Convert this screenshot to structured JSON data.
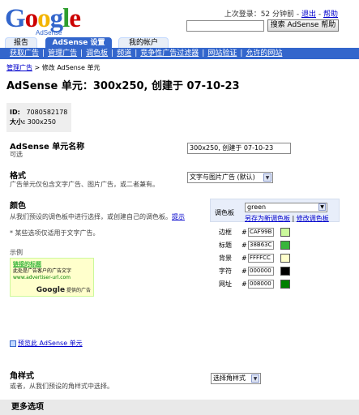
{
  "logo": {
    "text": "Google",
    "sub": "AdSense",
    "letters": [
      {
        "c": "G",
        "color": "#3366cc"
      },
      {
        "c": "o",
        "color": "#cc0000"
      },
      {
        "c": "o",
        "color": "#f3b400"
      },
      {
        "c": "g",
        "color": "#3366cc"
      },
      {
        "c": "l",
        "color": "#2e9e2e"
      },
      {
        "c": "e",
        "color": "#cc0000"
      }
    ]
  },
  "header": {
    "last_login": "上次登录：52 分钟前 - ",
    "logout": "退出",
    "sep": " - ",
    "help": "帮助",
    "search_button": "搜索 AdSense 帮助",
    "search_value": ""
  },
  "tabs": [
    {
      "label": "报告",
      "active": false
    },
    {
      "label": "AdSense 设置",
      "active": true
    },
    {
      "label": "我的帐户",
      "active": false
    }
  ],
  "subnav": [
    "获取广告",
    "管理广告",
    "调色板",
    "频道",
    "竞争性广告过滤器",
    "网站验证",
    "允许的网站"
  ],
  "breadcrumb": {
    "link": "管理广告",
    "rest": " > 修改 AdSense 单元"
  },
  "page_title": "AdSense 单元：300x250, 创建于 07-10-23",
  "info": {
    "id_label": "ID:",
    "id_value": "7080582178",
    "size_label": "大小:",
    "size_value": "300x250"
  },
  "unit_name": {
    "label": "AdSense 单元名称",
    "hint": "可选",
    "value": "300x250, 创建于 07-10-23"
  },
  "format": {
    "label": "格式",
    "hint": "广告单元仅包含文字广告、图片广告，或二者兼有。",
    "selected": "文字与图片广告 (默认)"
  },
  "colors": {
    "label": "颜色",
    "hint": "从我们预设的调色板中进行选择，或创建自己的调色板。",
    "hint_link": "提示",
    "note": "* 某些选项仅适用于文字广告。",
    "palette_label": "调色板",
    "palette_selected": "green",
    "save_link": "另存为新调色板",
    "sep": " | ",
    "edit_link": "修改调色板",
    "rows": [
      {
        "label": "边框",
        "value": "CAF99B",
        "color": "#caf99b"
      },
      {
        "label": "标题",
        "value": "38B63C",
        "color": "#38b63c"
      },
      {
        "label": "背景",
        "value": "FFFFCC",
        "color": "#ffffcc"
      },
      {
        "label": "字符",
        "value": "000000",
        "color": "#000000"
      },
      {
        "label": "网址",
        "value": "008000",
        "color": "#008000"
      }
    ]
  },
  "sample": {
    "label": "示例",
    "title": "链接的标题",
    "desc1": "此处是广告客户的广告文字",
    "url": "www.advertiser-url.com",
    "google": "Google",
    "google_tail": " 提供的广告"
  },
  "preview_link": "预览此 AdSense 单元",
  "corner": {
    "label": "角样式",
    "hint": "或者，从我们预设的角样式中选择。",
    "selected": "选择角样式"
  },
  "more_options": "更多选项"
}
